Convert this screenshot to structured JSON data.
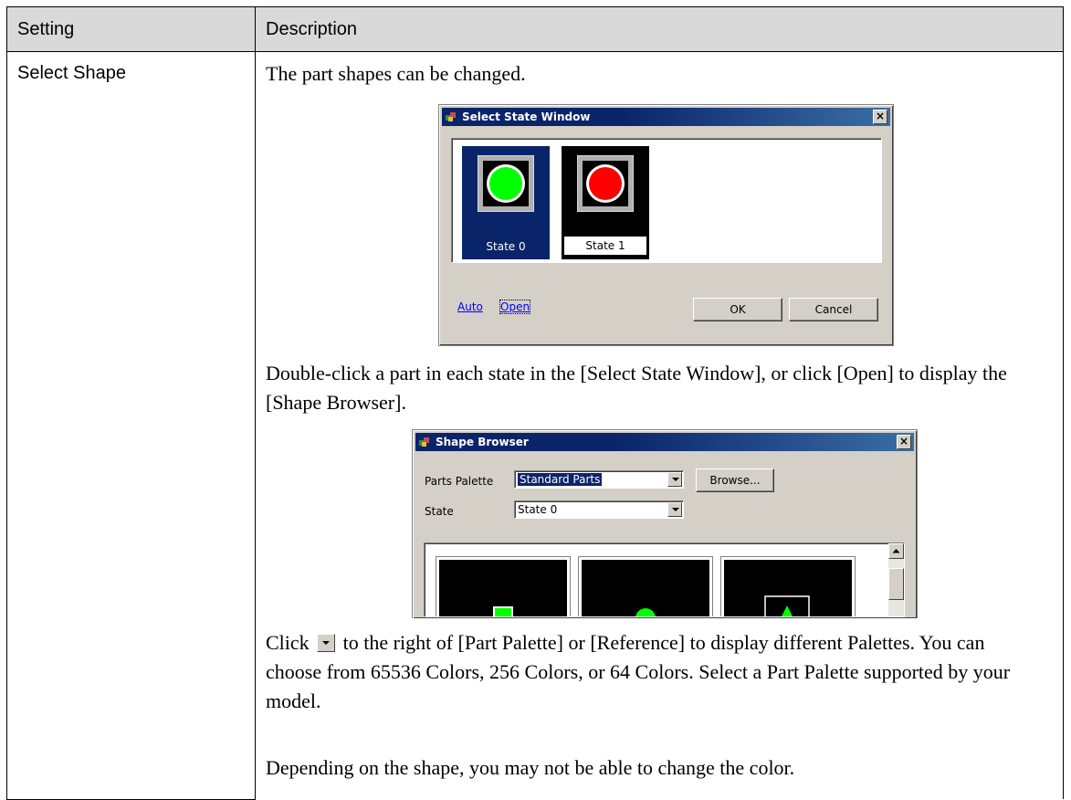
{
  "table": {
    "header_setting": "Setting",
    "header_description": "Description",
    "row_setting": "Select Shape"
  },
  "desc": {
    "p1": "The part shapes can be changed.",
    "p2": "Double-click a part in each state in the [Select State Window], or click [Open] to display the [Shape Browser].",
    "p3_before": "Click",
    "p3_after": "to the right of [Part Palette] or [Reference] to display different Palettes. You can choose from 65536 Colors, 256 Colors, or 64 Colors. Select a Part Palette supported by your model.",
    "p4": "Depending on the shape, you may not be able to change the color."
  },
  "select_state_window": {
    "title": "Select State Window",
    "close_glyph": "×",
    "states": [
      {
        "label": "State 0",
        "lamp_color": "#00ff00",
        "selected": true
      },
      {
        "label": "State 1",
        "lamp_color": "#ff0000",
        "selected": false
      }
    ],
    "links": {
      "auto": "Auto",
      "open": "Open"
    },
    "buttons": {
      "ok": "OK",
      "cancel": "Cancel"
    }
  },
  "shape_browser": {
    "title": "Shape Browser",
    "close_glyph": "×",
    "parts_palette_label": "Parts Palette",
    "parts_palette_value": "Standard Parts",
    "browse_button": "Browse...",
    "state_label": "State",
    "state_value": "State 0"
  },
  "colors": {
    "title_bar": "#0a246a",
    "dialog_face": "#d4d0c8",
    "header_bg": "#d9d9d9",
    "lamp_green": "#00ff00",
    "lamp_red": "#ff0000"
  }
}
